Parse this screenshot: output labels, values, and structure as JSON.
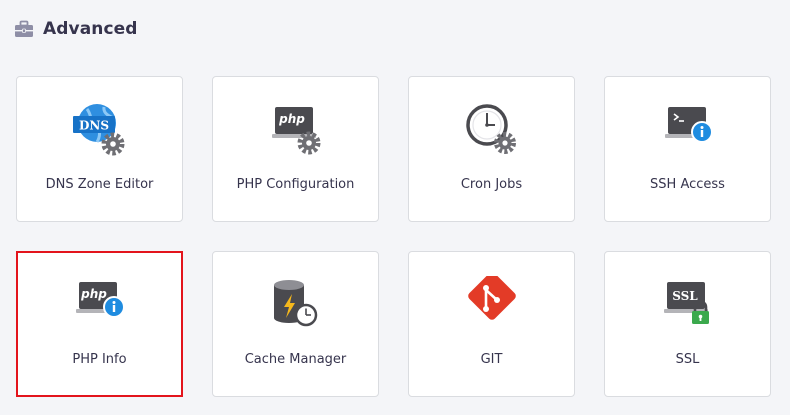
{
  "section": {
    "title": "Advanced",
    "icon": "toolbox-icon"
  },
  "tools": [
    {
      "label": "DNS Zone Editor",
      "icon": "dns-settings-icon",
      "selected": false
    },
    {
      "label": "PHP Configuration",
      "icon": "php-settings-icon",
      "selected": false
    },
    {
      "label": "Cron Jobs",
      "icon": "clock-settings-icon",
      "selected": false
    },
    {
      "label": "SSH Access",
      "icon": "terminal-info-icon",
      "selected": false
    },
    {
      "label": "PHP Info",
      "icon": "php-info-icon",
      "selected": true
    },
    {
      "label": "Cache Manager",
      "icon": "database-cache-icon",
      "selected": false
    },
    {
      "label": "GIT",
      "icon": "git-icon",
      "selected": false
    },
    {
      "label": "SSL",
      "icon": "ssl-lock-icon",
      "selected": false
    }
  ],
  "colors": {
    "selected_border": "#e3141c",
    "accent_blue": "#1f8ce0",
    "gear_gray": "#6f6f74",
    "git_red": "#e33b27",
    "lock_green": "#3ba94d"
  }
}
